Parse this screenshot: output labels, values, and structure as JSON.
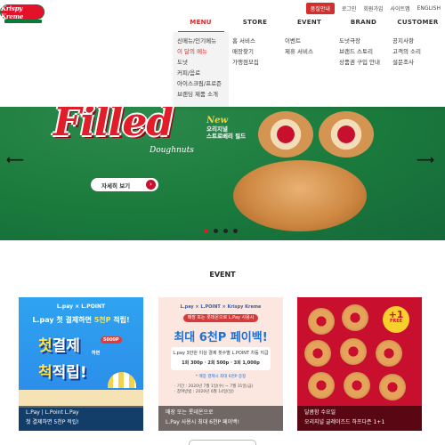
{
  "brand": {
    "logo_text": "Krispy Kreme"
  },
  "utility": {
    "order_label": "품질안내",
    "links": [
      "로그인",
      "회원가입",
      "사이트맵",
      "ENGLISH"
    ]
  },
  "nav": {
    "items": [
      "MENU",
      "STORE",
      "EVENT",
      "BRAND",
      "CUSTOMER"
    ],
    "active": "MENU"
  },
  "mega_menu": {
    "menu": [
      "신메뉴/인기메뉴",
      "이 달의 메뉴",
      "도넛",
      "커피/음료",
      "아이스크림/프로즌",
      "브랜딩 제품 소개"
    ],
    "store": [
      "홈 서비스",
      "매장찾기",
      "가맹점모집"
    ],
    "event": [
      "이벤트",
      "제휴 서비스"
    ],
    "brand": [
      "도넛극장",
      "브랜드 스토리",
      "상품권 구입 안내"
    ],
    "customer": [
      "공지사항",
      "고객의 소리",
      "설문조사"
    ]
  },
  "hero": {
    "headline": "Filled",
    "sub": "Doughnuts",
    "new_label": "New",
    "new_desc_1": "오리지널",
    "new_desc_2": "스트로베리 필드",
    "cta": "자세히 보기",
    "slides": 4,
    "active_slide": 1,
    "prev": "⟵",
    "next": "⟶"
  },
  "event": {
    "title": "EVENT",
    "cards": [
      {
        "brand": "L.pay × L.POINT",
        "head_a": "L.pay 첫 결제하면 ",
        "head_b": "5천P",
        "head_c": " 적립!",
        "big1_a": "첫",
        "big1_b": "결제",
        "big2_a": "척",
        "big2_b": "적립!",
        "small": "하면",
        "amount": "5000P",
        "caption_1": "L.Pay | L.Point L.Pay",
        "caption_2": "첫 결제하면 5천P 적립!"
      },
      {
        "brand": "L.pay × L.POINT × Krispy Kreme",
        "pill": "매장 또는 롯데온으로 L.Pay 사용시",
        "big": "최대 6천P 페이백!",
        "box_1": "L.pay 3만원 이상 결제 횟수별 L.POINT 차등 지급",
        "box_2": "1회 300p · 2회 500p · 3회 1,000p",
        "note": "* 매장 결제시 최대 6천P 증정",
        "dates_1": "· 기간 : 2020년 7월 1일(수) ~ 7월 31일(금)",
        "dates_2": "· 참여방법 : 2020년 6월 14일(일)",
        "caption_1": "매장 또는 롯데온으로",
        "caption_2": "L.Pay 사용시 최대 6천P 페이백!"
      },
      {
        "badge": "+1",
        "badge_small": "FREE",
        "caption_1": "달콤함 수요일",
        "caption_2": "오리지널 글레이즈드 하프다즌 1+1"
      }
    ]
  },
  "colors": {
    "brand_red": "#c8102e",
    "brand_green": "#1b7a3d",
    "nav_active": "#d42a2a"
  }
}
